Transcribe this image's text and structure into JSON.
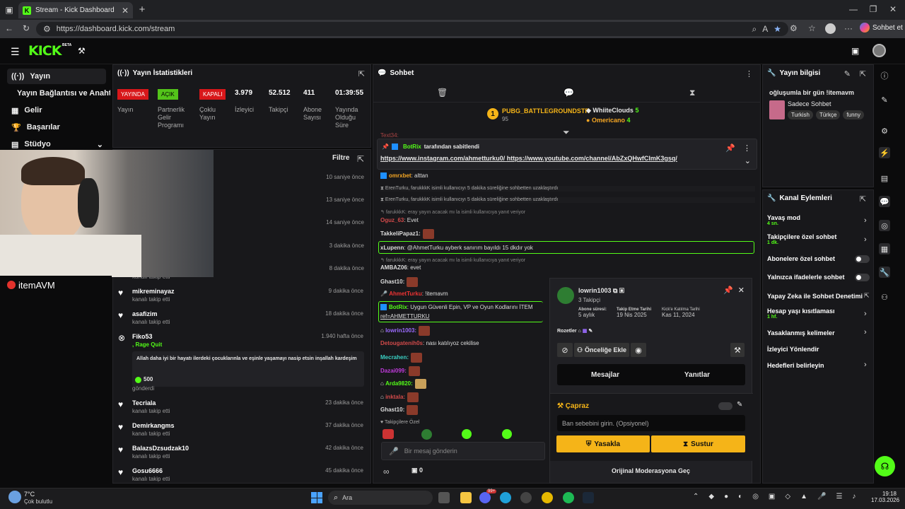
{
  "browser": {
    "tab_title": "Stream - Kick Dashboard",
    "url": "https://dashboard.kick.com/stream",
    "profile_label": "Sohbet et"
  },
  "header": {
    "logo": "KICK",
    "beta": "BETA"
  },
  "sidebar": {
    "items": [
      {
        "label": "Yayın"
      },
      {
        "label": "Yayın Bağlantısı ve Anahtarı"
      },
      {
        "label": "Gelir"
      },
      {
        "label": "Başarılar"
      },
      {
        "label": "Stüdyo"
      }
    ]
  },
  "stats": {
    "title": "Yayın İstatistikleri",
    "badges": [
      {
        "text": "YAYINDA",
        "color": "#d8171a"
      },
      {
        "text": "AÇIK",
        "color": "#53c41a"
      },
      {
        "text": "KAPALI",
        "color": "#d8171a"
      }
    ],
    "labels": [
      {
        "text": "Yayın"
      },
      {
        "text": "Partnerlik\nGelir\nProgramı"
      },
      {
        "text": "Çoklu\nYayın"
      },
      {
        "text": "İzleyici"
      },
      {
        "text": "Takipçi"
      },
      {
        "text": "Abone\nSayısı"
      },
      {
        "text": "Yayında\nOlduğu\nSüre"
      }
    ],
    "values": [
      "3.979",
      "52.512",
      "411",
      "01:39:55"
    ]
  },
  "activity": {
    "filter_label": "Filtre",
    "overlay_brand": "itemAVM",
    "hidden_times": [
      "10 saniye önce",
      "13 saniye önce",
      "14 saniye önce",
      "3 dakika önce",
      "8 dakika önce"
    ],
    "partial": "kanalı takip etti",
    "items": [
      {
        "name": "mikreminayaz",
        "sub": "kanalı takip etti",
        "time": "9 dakika önce"
      },
      {
        "name": "asafizim",
        "sub": "kanalı takip etti",
        "time": "18 dakika önce"
      },
      {
        "name": "Fiko53",
        "sub": ", Rage Quit",
        "time": "1.940 hafta önce",
        "message": "Allah daha iyi bir hayatı ilerdeki çocuklarınla ve eşinle yaşamayı nasip etsin inşallah kardeşim",
        "amount": "500",
        "sent": "gönderdi"
      },
      {
        "name": "Tecriala",
        "sub": "kanalı takip etti",
        "time": "23 dakika önce"
      },
      {
        "name": "Demirkangms",
        "sub": "kanalı takip etti",
        "time": "37 dakika önce"
      },
      {
        "name": "BalazsDzsudzak10",
        "sub": "kanalı takip etti",
        "time": "42 dakika önce"
      },
      {
        "name": "Gosu6666",
        "sub": "kanalı takip etti",
        "time": "45 dakika önce"
      }
    ]
  },
  "chat": {
    "title": "Sohbet",
    "leader1": {
      "rank": "1",
      "name": "PUBG_BATTLEGROUNDSTR",
      "value": "95"
    },
    "leader2": {
      "name": "WhiiteClouds",
      "value": "5"
    },
    "leader3": {
      "name": "Omericano",
      "value": "4"
    },
    "pinned": {
      "by": "BotRix",
      "suffix": "tarafından sabitlendi",
      "link1": "https://www.instagram.com/ahmetturku0/",
      "link2": "https://www.youtube.com/channel/AbZxQHwfCImK3gsq/"
    },
    "partial_top": "Text34:",
    "lines": {
      "l1_user": "omrxbet",
      "l1_msg": ": alttan",
      "l2": "ErenTurku, farukkkK isimli kullanıcıyı 5 dakika süreliğine sohbetten uzaklaştırdı",
      "l3": "ErenTurku, farukkkK isimli kullanıcıyı 5 dakika süreliğine sohbetten uzaklaştırdı",
      "l4": "farukkkK: eray yayın acacak mı la isimli kullanıcıya yanıt veriyor",
      "l5_user": "Oguz_63",
      "l5_msg": ": Evet",
      "l6_user": "TakkeliPapaz1:",
      "l7_user": "xLupenn",
      "l7_msg": ": @AhmetTurku ayberk sanırım bayıldı 15 dkdır yok",
      "l8": "farukkkK: eray yayın acacak mı la isimli kullanıcıya yanıt veriyor",
      "l9_user": "AMBAZ06",
      "l9_msg": ": evet",
      "l10_user": "Ghast10:",
      "l11_user": "AhmetTurku",
      "l11_msg": ": !itemavm",
      "l12_user": "BotRix",
      "l12_msg": ": Uygun Güvenli Epin, VP ve Oyun Kodlarını İTEM",
      "l12_b": "ref=AHMETTURKU",
      "l13_user": "lowrin1003:",
      "l14_user": "Detougatenih0s",
      "l14_msg": ": nası katılıyoz cekilise",
      "l15_user": "Mecrahen:",
      "l16_user": "Dazai099:",
      "l17_user": "Arda9820:",
      "l18_user": "inktala:",
      "l19_user": "Ghast10:"
    },
    "mode": "Takipçilere Özel",
    "input_placeholder": "Bir mesaj gönderin",
    "count": "0"
  },
  "info": {
    "title": "Yayın bilgisi",
    "stream_title": "oğluşumla bir gün !itemavm",
    "category": "Sadece Sohbet",
    "tags": [
      "Turkish",
      "Türkçe",
      "funny"
    ]
  },
  "actions": {
    "title": "Kanal Eylemleri",
    "items": [
      {
        "label": "Yavaş mod",
        "sub": "4 sn."
      },
      {
        "label": "Takipçilere özel sohbet",
        "sub": "1 dk."
      },
      {
        "label": "Abonelere özel sohbet"
      },
      {
        "label": "Yalnızca ifadelerle sohbet"
      },
      {
        "label": "Yapay Zeka ile Sohbet Denetimi"
      },
      {
        "label": "Hesap yaşı kısıtlaması",
        "sub": "1 hf."
      },
      {
        "label": "Yasaklanmış kelimeler"
      },
      {
        "label": "İzleyici Yönlendir"
      },
      {
        "label": "Hedefleri belirleyin"
      }
    ]
  },
  "user_card": {
    "username": "lowrin1003",
    "followers": "3 Takipçi",
    "info": [
      {
        "k": "Abone süresi:",
        "v": "5 aylık"
      },
      {
        "k": "Takip Etme Tarihi",
        "v": "19 Nis 2025"
      },
      {
        "k": "Kick'e Katılma Tarihi",
        "v": "Kas 11, 2024"
      }
    ],
    "badges_label": "Rozetler",
    "priority_btn": "Önceliğe Ekle",
    "tab_messages": "Mesajlar",
    "tab_replies": "Yanıtlar",
    "cross_label": "Çapraz",
    "ban_placeholder": "Ban sebebini girin. (Opsiyonel)",
    "ban_btn": "Yasakla",
    "mute_btn": "Sustur",
    "footer": "Orijinal Moderasyona Geç"
  },
  "taskbar": {
    "temp": "7°C",
    "weather": "Çok bulutlu",
    "search": "Ara",
    "time": "19:18",
    "date": "17.03.2026",
    "notif": "99+"
  }
}
